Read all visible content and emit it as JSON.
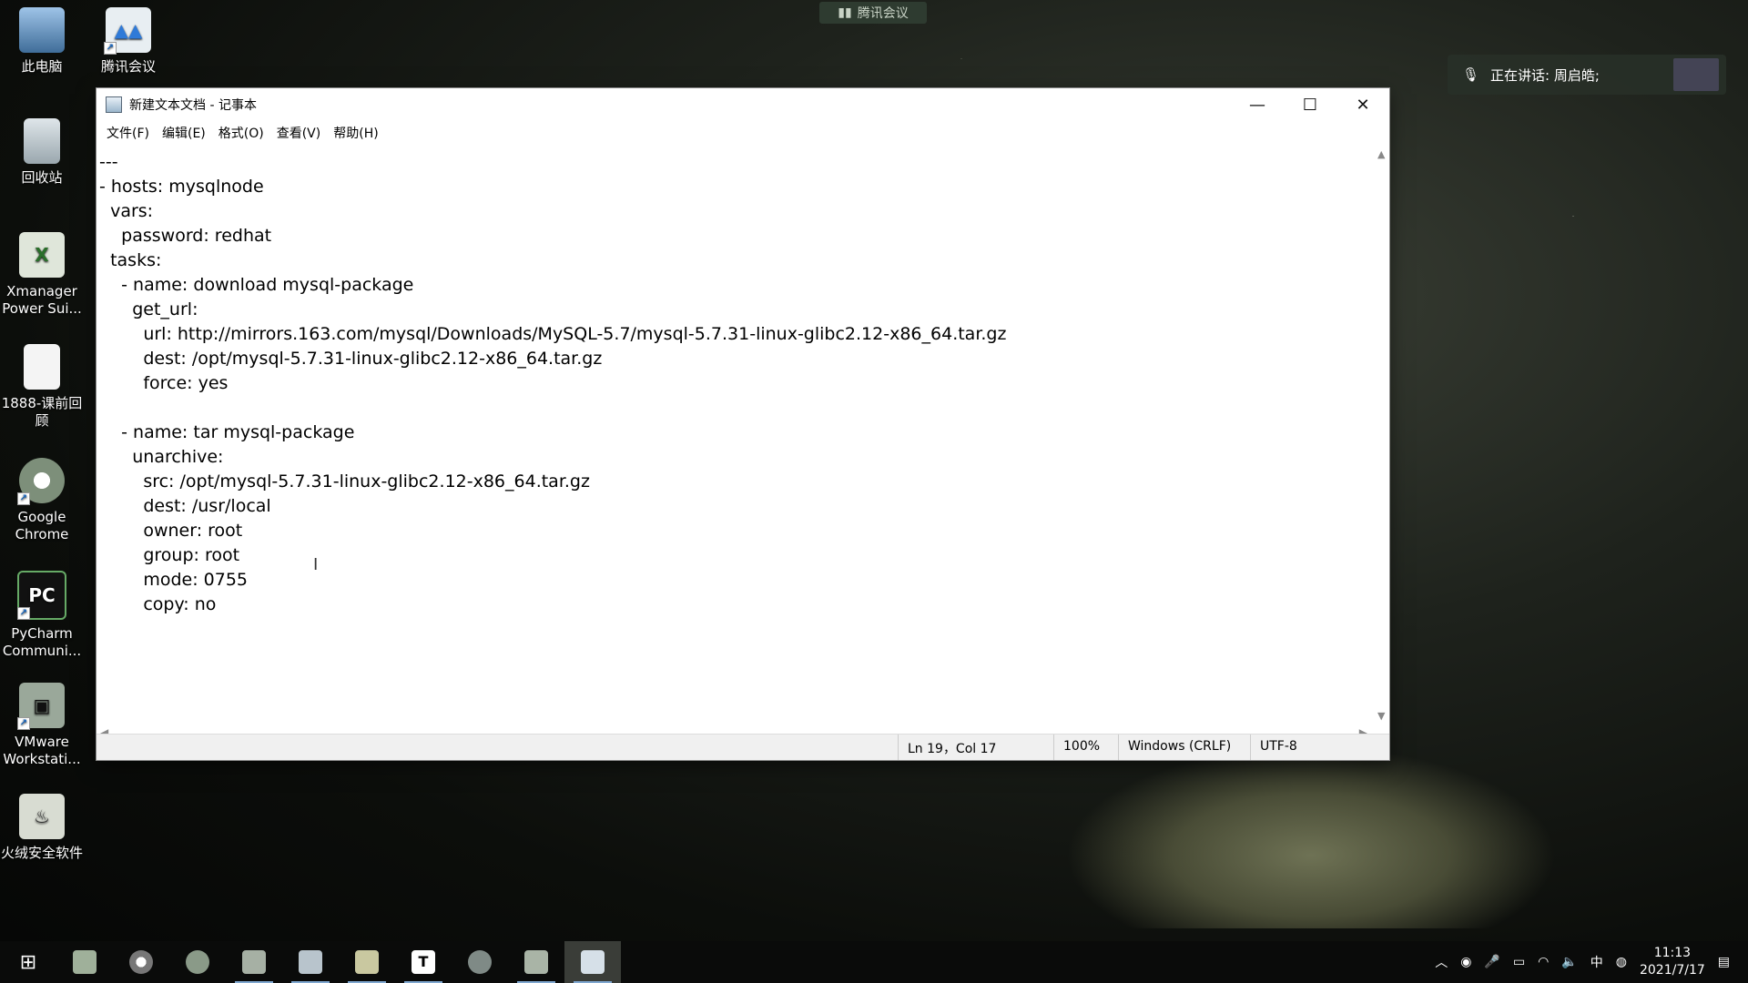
{
  "desktop": {
    "icons": [
      {
        "label": "此电脑",
        "icon": "computer-icon"
      },
      {
        "label": "腾讯会议",
        "icon": "tencent-meeting-icon"
      },
      {
        "label": "回收站",
        "icon": "recycle-bin-icon"
      },
      {
        "label": "Xmanager Power Sui...",
        "icon": "xmanager-icon"
      },
      {
        "label": "1888-课前回顾",
        "icon": "document-icon"
      },
      {
        "label": "Google Chrome",
        "icon": "chrome-icon"
      },
      {
        "label": "PyCharm Communi...",
        "icon": "pycharm-icon"
      },
      {
        "label": "VMware Workstati...",
        "icon": "vmware-icon"
      },
      {
        "label": "火绒安全软件",
        "icon": "huorong-icon"
      }
    ]
  },
  "meeting": {
    "bar_label": "腾讯会议",
    "speaker_text": "正在讲话: 周启皓;"
  },
  "notepad": {
    "title": "新建文本文档 - 记事本",
    "menu": [
      "文件(F)",
      "编辑(E)",
      "格式(O)",
      "查看(V)",
      "帮助(H)"
    ],
    "content": "---\n- hosts: mysqlnode\n  vars:\n    password: redhat\n  tasks:\n    - name: download mysql-package\n      get_url:\n        url: http://mirrors.163.com/mysql/Downloads/MySQL-5.7/mysql-5.7.31-linux-glibc2.12-x86_64.tar.gz\n        dest: /opt/mysql-5.7.31-linux-glibc2.12-x86_64.tar.gz\n        force: yes\n\n    - name: tar mysql-package\n      unarchive:\n        src: /opt/mysql-5.7.31-linux-glibc2.12-x86_64.tar.gz\n        dest: /usr/local\n        owner: root\n        group: root\n        mode: 0755\n        copy: no",
    "status": {
      "position": "Ln 19，Col 17",
      "zoom": "100%",
      "line_ending": "Windows (CRLF)",
      "encoding": "UTF-8"
    }
  },
  "taskbar": {
    "apps": [
      "xmanager-icon",
      "chrome-icon",
      "wechat-icon",
      "vmware-icon",
      "tencent-meeting-icon",
      "file-explorer-icon",
      "typora-icon",
      "browser-icon",
      "xshell-icon",
      "notepad-icon"
    ],
    "tray": {
      "ime": "中",
      "time": "11:13",
      "date": "2021/7/17"
    }
  }
}
